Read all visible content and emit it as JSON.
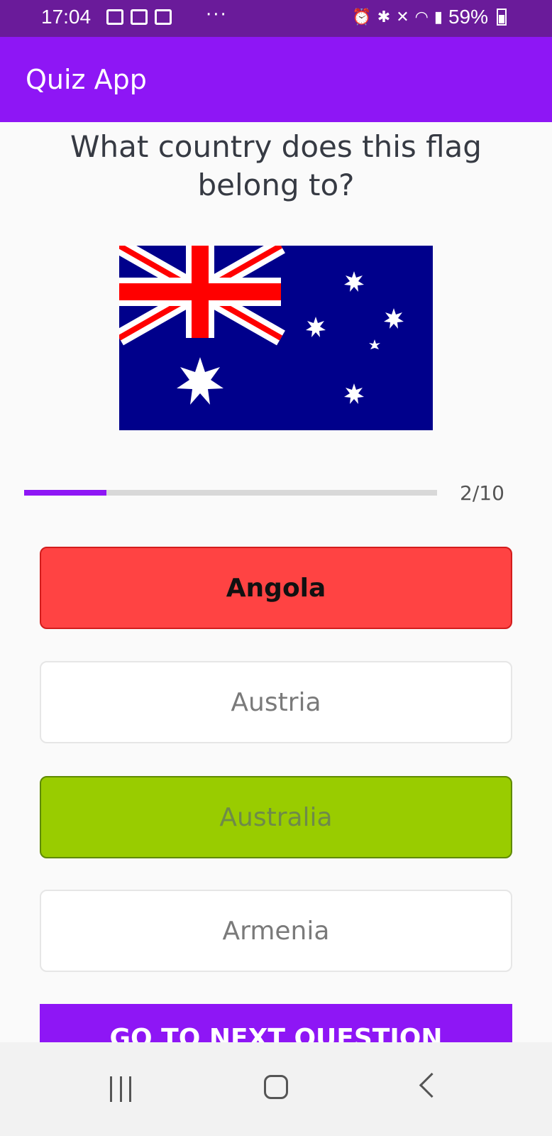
{
  "status_bar": {
    "time": "17:04",
    "more": "···",
    "battery": "59%",
    "icons": [
      "gallery-icon",
      "gmail-icon",
      "notification-icon",
      "alarm-icon",
      "bluetooth-icon",
      "mute-icon",
      "wifi-icon",
      "signal-icon",
      "battery-icon"
    ]
  },
  "app_bar": {
    "title": "Quiz App"
  },
  "question": {
    "text": "What country does this flag belong to?"
  },
  "flag": {
    "name": "australia-flag",
    "colors": {
      "blue": "#00008b",
      "red": "#ff0000",
      "white": "#ffffff"
    }
  },
  "progress": {
    "label": "2/10",
    "current": 2,
    "total": 10,
    "fraction": 0.2
  },
  "options": [
    {
      "label": "Angola",
      "state": "wrong"
    },
    {
      "label": "Austria",
      "state": "neutral"
    },
    {
      "label": "Australia",
      "state": "correct"
    },
    {
      "label": "Armenia",
      "state": "neutral"
    }
  ],
  "next_button": {
    "label": "GO TO NEXT QUESTION"
  },
  "colors": {
    "primary": "#8e16f5",
    "status_bar": "#6a1b9a",
    "wrong": "#ff4343",
    "correct": "#99cc00"
  }
}
